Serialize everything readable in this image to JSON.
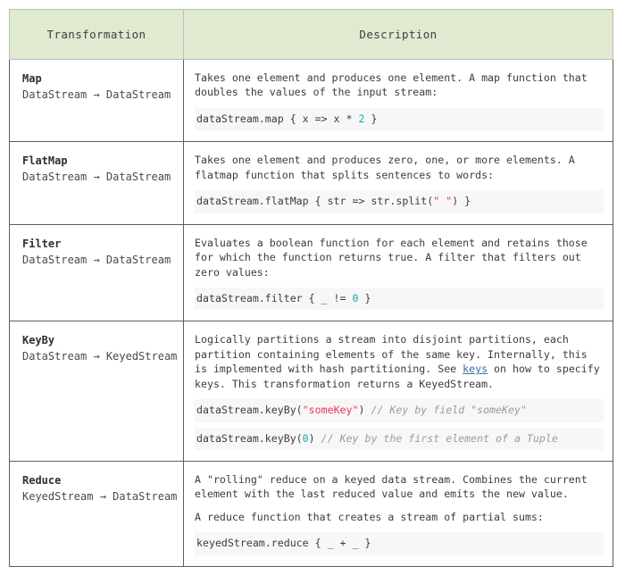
{
  "table": {
    "columns": [
      {
        "key": "transformation",
        "label": "Transformation"
      },
      {
        "key": "description",
        "label": "Description"
      }
    ],
    "rows": [
      {
        "name": "Map",
        "signature": "DataStream → DataStream",
        "description": "Takes one element and produces one element. A map function that doubles the values of the input stream:",
        "code": [
          {
            "pre": "dataStream.map { x => x * ",
            "num": "2",
            "post": " }"
          }
        ]
      },
      {
        "name": "FlatMap",
        "signature": "DataStream → DataStream",
        "description": "Takes one element and produces zero, one, or more elements. A flatmap function that splits sentences to words:",
        "code": [
          {
            "pre": "dataStream.flatMap { str => str.split(",
            "str": "\" \"",
            "post": ") }"
          }
        ]
      },
      {
        "name": "Filter",
        "signature": "DataStream → DataStream",
        "description": "Evaluates a boolean function for each element and retains those for which the function returns true. A filter that filters out zero values:",
        "code": [
          {
            "pre": "dataStream.filter { _ != ",
            "num": "0",
            "post": " }"
          }
        ]
      },
      {
        "name": "KeyBy",
        "signature": "DataStream → KeyedStream",
        "description_before_link": "Logically partitions a stream into disjoint partitions, each partition containing elements of the same key. Internally, this is implemented with hash partitioning. See ",
        "link_text": "keys",
        "description_after_link": " on how to specify keys. This transformation returns a KeyedStream.",
        "code": [
          {
            "pre": "dataStream.keyBy(",
            "str": "\"someKey\"",
            "post": ") ",
            "comment": "// Key by field \"someKey\""
          },
          {
            "pre": "dataStream.keyBy(",
            "num": "0",
            "post": ") ",
            "comment": "// Key by the first element of a Tuple"
          }
        ]
      },
      {
        "name": "Reduce",
        "signature": "KeyedStream → DataStream",
        "description": "A \"rolling\" reduce on a keyed data stream. Combines the current element with the last reduced value and emits the new value.",
        "description2": "A reduce function that creates a stream of partial sums:",
        "code": [
          {
            "pre": "keyedStream.reduce { _ + _ }"
          }
        ]
      }
    ]
  },
  "colors": {
    "header_background": "#dfead0",
    "code_background": "#f7f7f7",
    "number_token": "#1aa8a8",
    "string_token": "#e8345a",
    "comment_token": "#9b9b9b",
    "link": "#3a6ea5",
    "border": "#5d5f5d"
  }
}
